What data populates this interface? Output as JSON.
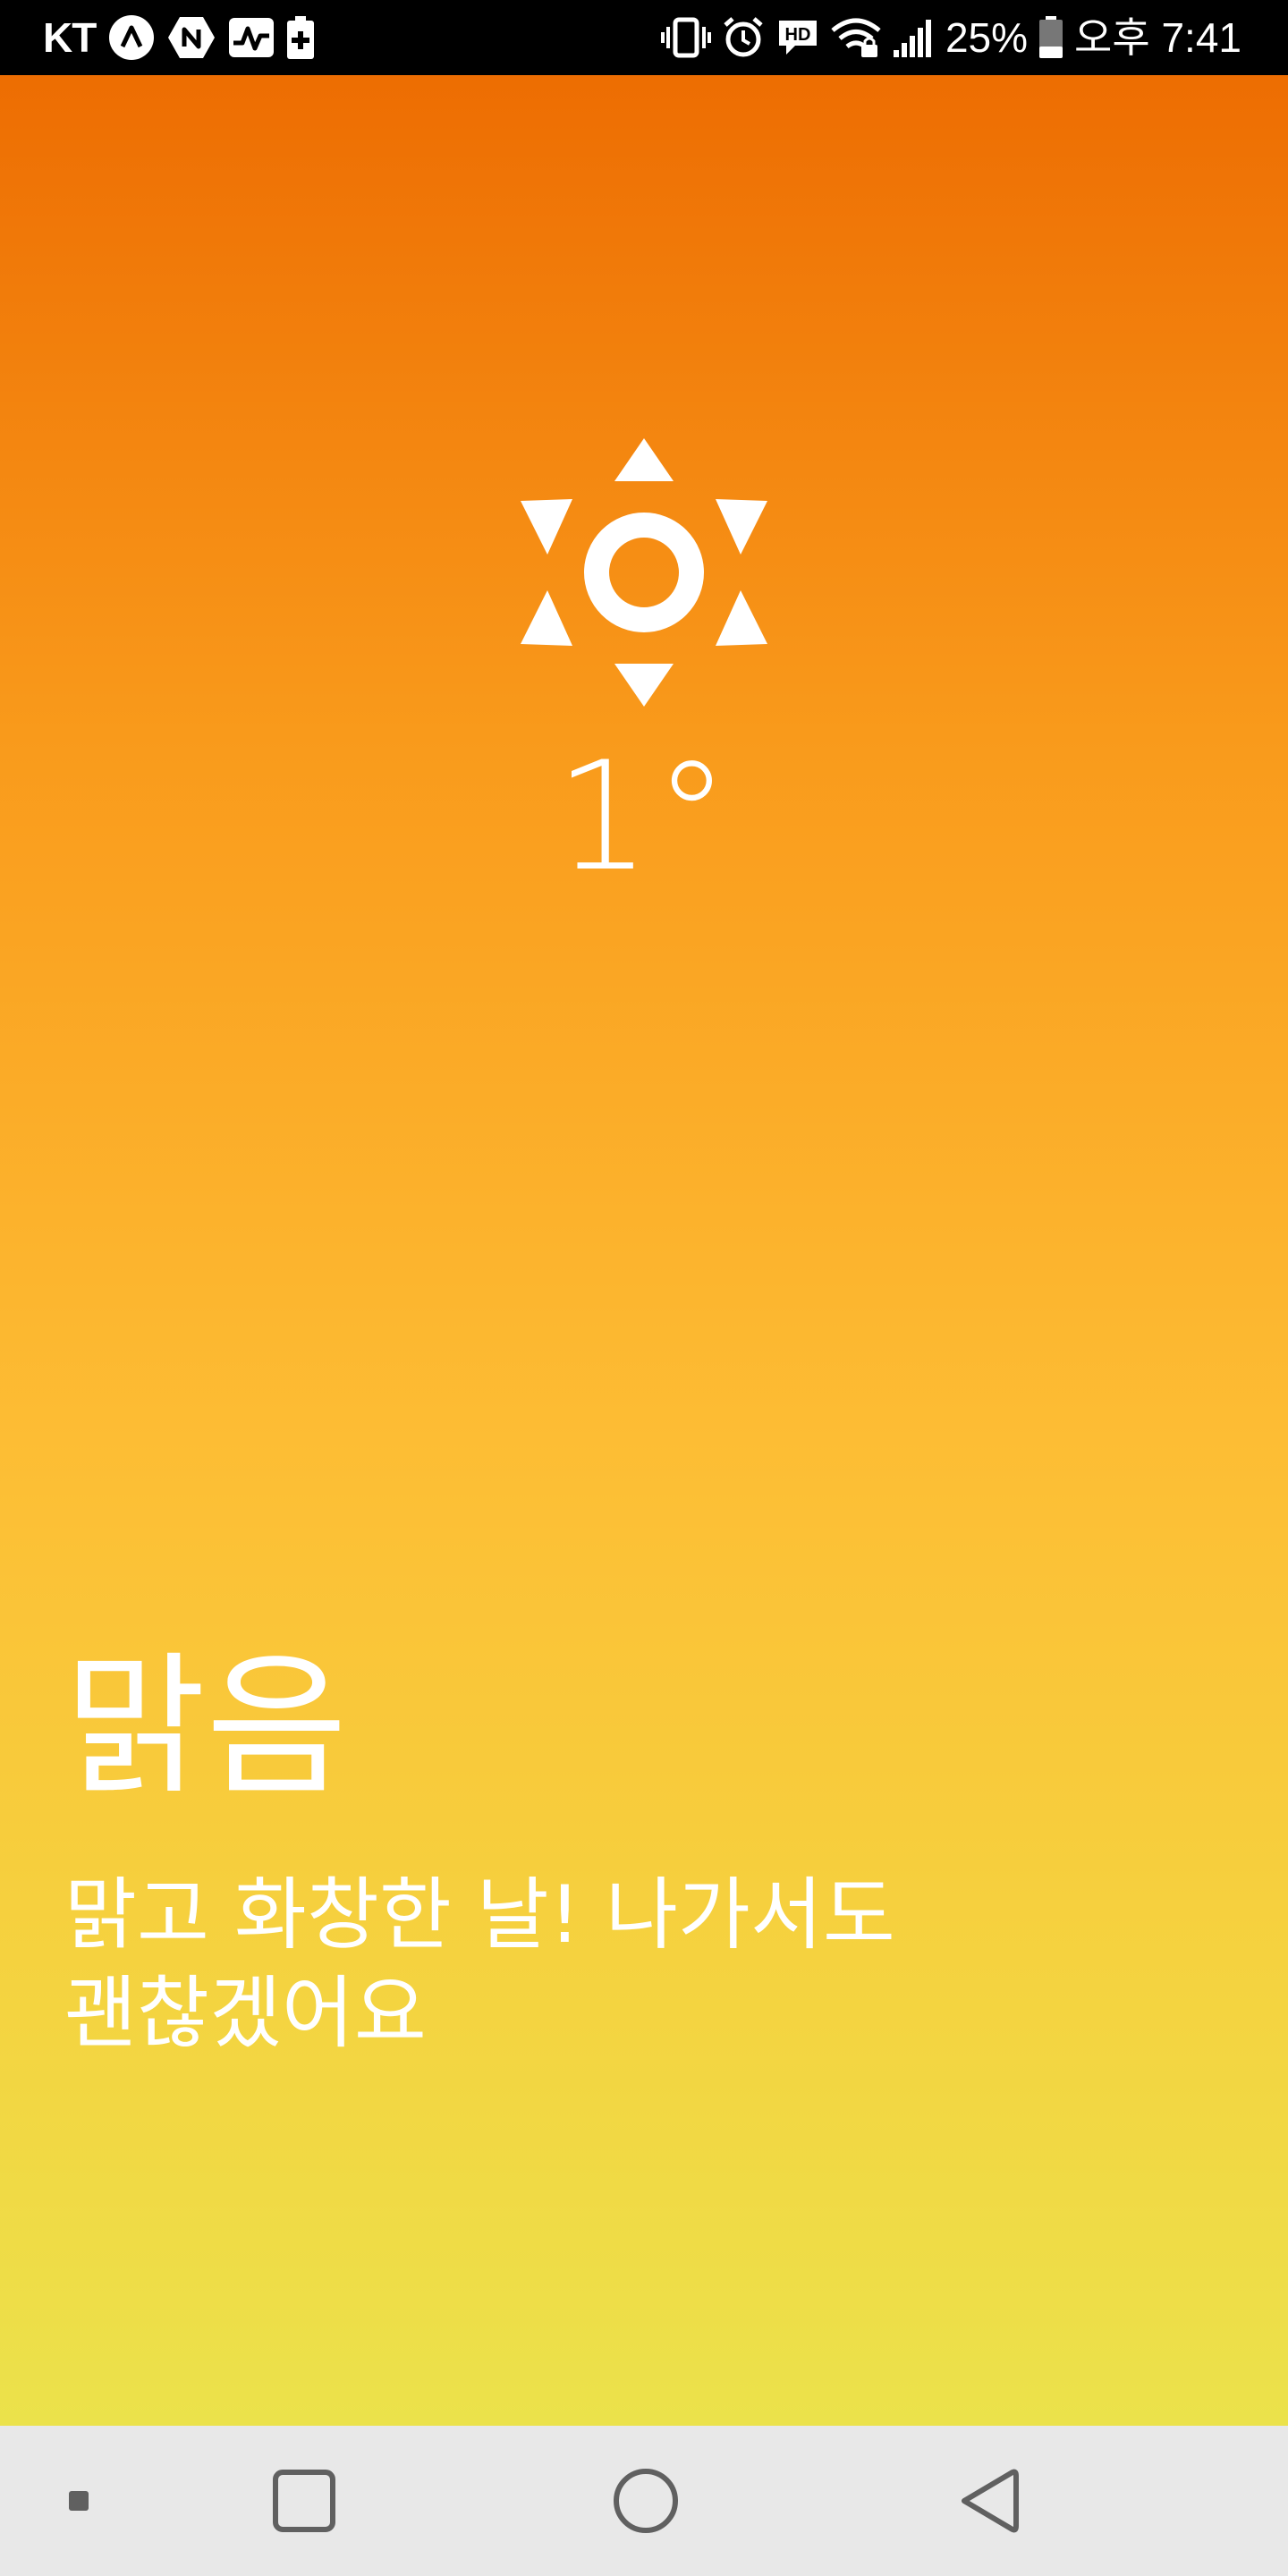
{
  "status_bar": {
    "carrier": "KT",
    "icons_left": [
      "lambda-icon",
      "n-icon",
      "pulse-icon",
      "battery-plus-icon"
    ],
    "icons_right": [
      "vibrate-icon",
      "alarm-icon",
      "hd-icon",
      "wifi-icon",
      "signal-icon"
    ],
    "battery_percent": "25%",
    "time": "오후 7:41"
  },
  "weather": {
    "icon": "sun-icon",
    "temperature": "1°",
    "condition": "맑음",
    "description": "맑고 화창한 날! 나가서도 괜찮겠어요"
  },
  "nav_bar": {
    "buttons": [
      "dot-icon",
      "recents-icon",
      "home-icon",
      "back-icon"
    ]
  },
  "colors": {
    "gradient_top": "#ED6D02",
    "gradient_mid": "#FDBD34",
    "gradient_bottom": "#EBE24B",
    "nav_bg": "#E8E8E8",
    "text": "#FFFFFF"
  }
}
